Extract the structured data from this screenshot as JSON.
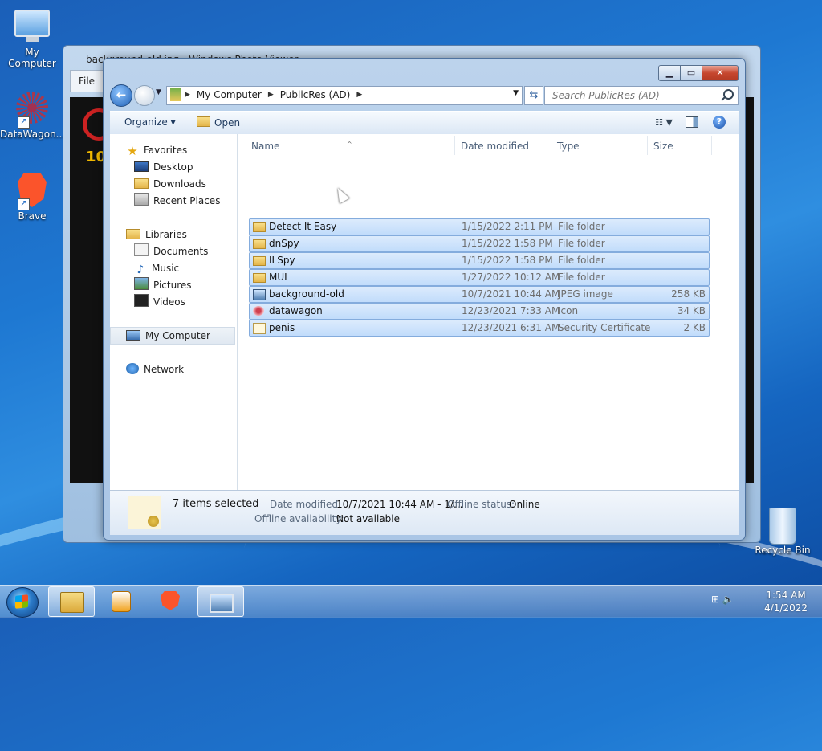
{
  "desktop": {
    "icons": [
      {
        "label": "My Computer"
      },
      {
        "label": "DataWagon..."
      },
      {
        "label": "Brave"
      },
      {
        "label": "Recycle Bin"
      }
    ]
  },
  "background_window": {
    "title": "background-old.jpg - Windows Photo Viewer",
    "menu_file": "File",
    "image_text": "10"
  },
  "explorer": {
    "controls": {
      "minimize": "▁",
      "maximize": "▭",
      "close": "✕"
    },
    "address": {
      "crumbs": [
        "My Computer",
        "PublicRes (AD)"
      ]
    },
    "search": {
      "placeholder": "Search PublicRes (AD)"
    },
    "toolbar": {
      "organize": "Organize ▾",
      "open": "Open",
      "help": "?"
    },
    "nav": {
      "favorites": "Favorites",
      "desktop": "Desktop",
      "downloads": "Downloads",
      "recent_places": "Recent Places",
      "libraries": "Libraries",
      "documents": "Documents",
      "music": "Music",
      "pictures": "Pictures",
      "videos": "Videos",
      "my_computer": "My Computer",
      "network": "Network"
    },
    "columns": {
      "name": "Name",
      "date": "Date modified",
      "type": "Type",
      "size": "Size"
    },
    "files": [
      {
        "name": "Detect It Easy",
        "date": "1/15/2022 2:11 PM",
        "type": "File folder",
        "size": "",
        "icon": "folder-icon"
      },
      {
        "name": "dnSpy",
        "date": "1/15/2022 1:58 PM",
        "type": "File folder",
        "size": "",
        "icon": "folder-icon"
      },
      {
        "name": "ILSpy",
        "date": "1/15/2022 1:58 PM",
        "type": "File folder",
        "size": "",
        "icon": "folder-icon"
      },
      {
        "name": "MUI",
        "date": "1/27/2022 10:12 AM",
        "type": "File folder",
        "size": "",
        "icon": "folder-icon"
      },
      {
        "name": "background-old",
        "date": "10/7/2021 10:44 AM",
        "type": "JPEG image",
        "size": "258 KB",
        "icon": "jpeg-file-icon"
      },
      {
        "name": "datawagon",
        "date": "12/23/2021 7:33 AM",
        "type": "Icon",
        "size": "34 KB",
        "icon": "icon-file-icon"
      },
      {
        "name": "penis",
        "date": "12/23/2021 6:31 AM",
        "type": "Security Certificate",
        "size": "2 KB",
        "icon": "certificate-file-icon"
      }
    ],
    "details": {
      "count": "7 items selected",
      "date_label": "Date modified:",
      "date_value": "10/7/2021 10:44 AM - 1/...",
      "offline_status_label": "Offline status:",
      "offline_status_value": "Online",
      "offline_avail_label": "Offline availability:",
      "offline_avail_value": "Not available"
    }
  },
  "taskbar": {
    "time": "1:54 AM",
    "date": "4/1/2022"
  }
}
